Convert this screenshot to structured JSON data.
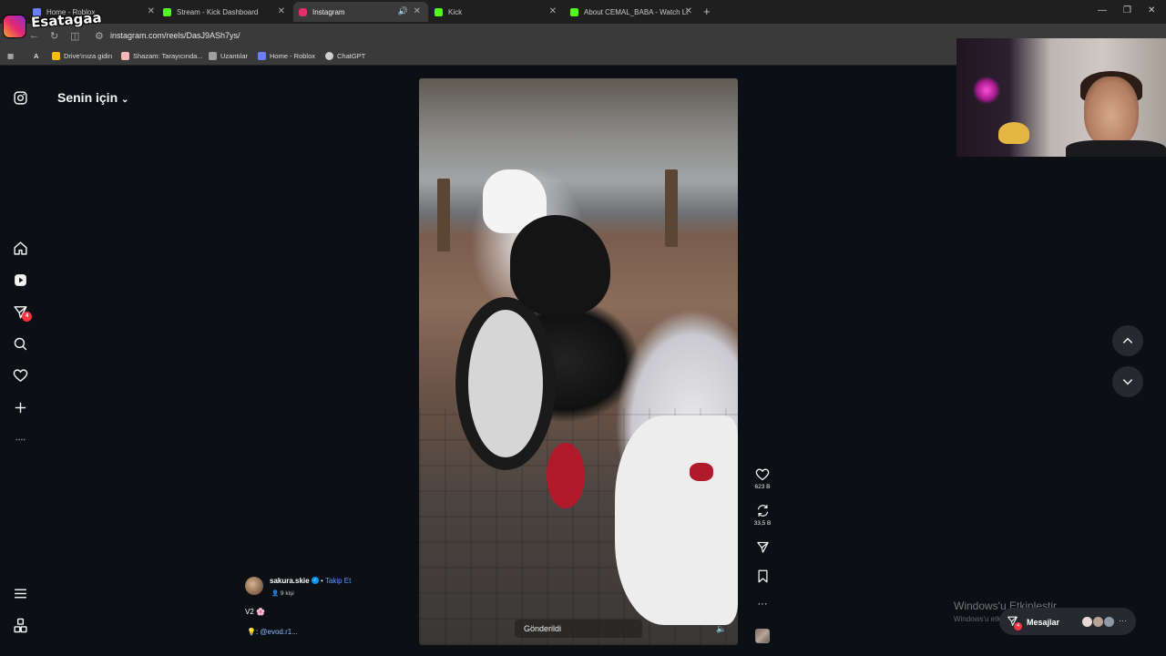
{
  "browser": {
    "tabs": [
      {
        "title": "Home - Roblox",
        "favicon_color": "#6b7cff"
      },
      {
        "title": "Stream - Kick Dashboard",
        "favicon_color": "#53fc18"
      },
      {
        "title": "Instagram",
        "favicon_color": "#e1306c",
        "active": true
      },
      {
        "title": "Kick",
        "favicon_color": "#53fc18"
      },
      {
        "title": "About CEMAL_BABA - Watch Li...",
        "favicon_color": "#53fc18"
      }
    ],
    "url": "instagram.com/reels/DasJ9ASh7ys/",
    "bookmarks": [
      {
        "label": "Drive'ınıza gidin",
        "icon_color": "#fbbc04"
      },
      {
        "label": "Shazam: Tarayıcında...",
        "icon_color": "#f6b6b6"
      },
      {
        "label": "Uzantılar",
        "icon_color": "#9e9e9e"
      },
      {
        "label": "Home - Roblox",
        "icon_color": "#6b7cff"
      },
      {
        "label": "ChatGPT",
        "icon_color": "#cfcfcf"
      }
    ]
  },
  "overlay": {
    "channel_name": "Esatagaa"
  },
  "instagram": {
    "header_title": "Senin için",
    "sidebar_badge": "4",
    "reel": {
      "status": "Gönderildi",
      "likes": "623 B",
      "reposts": "33,5 B"
    },
    "author": {
      "username": "sakura.skie",
      "separator": "•",
      "follow_label": "Takip Et",
      "followers": "9 kişi",
      "caption_line1": "V2 🌸",
      "caption_line2_prefix": "💡: ",
      "caption_mention": "@evod.r1..."
    },
    "messages": {
      "label": "Mesajlar",
      "badge": "4"
    }
  },
  "watermark": {
    "title": "Windows'u Etkinleştir",
    "subtitle": "Windows'u etkinleştirmek için Ayarlar'a gidin."
  },
  "colors": {
    "accent_blue": "#0095f6",
    "badge_red": "#ff3040",
    "page_bg": "#0c1014"
  }
}
